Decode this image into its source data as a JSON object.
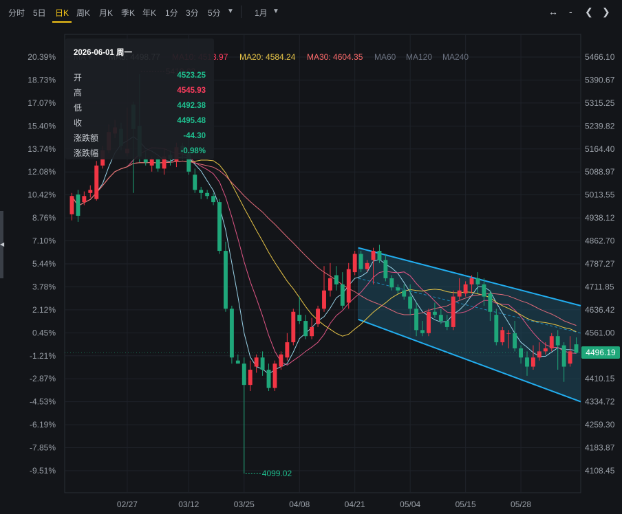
{
  "toolbar": {
    "periods": [
      {
        "label": "分时",
        "active": false
      },
      {
        "label": "5日",
        "active": false
      },
      {
        "label": "日K",
        "active": true
      },
      {
        "label": "周K",
        "active": false
      },
      {
        "label": "月K",
        "active": false
      },
      {
        "label": "季K",
        "active": false
      },
      {
        "label": "年K",
        "active": false
      },
      {
        "label": "1分",
        "active": false
      },
      {
        "label": "3分",
        "active": false
      },
      {
        "label": "5分",
        "active": false
      }
    ],
    "more_arrow": "▼",
    "range_label": "1月",
    "range_arrow": "▼",
    "right_icons": [
      "↔",
      "-",
      "❮",
      "❯"
    ]
  },
  "legend": {
    "prefix": "MA",
    "items": [
      {
        "label": "MA5: 4498.77",
        "color": "#e8e8e8"
      },
      {
        "label": "MA10: 4513.97",
        "color": "#ff3d5e"
      },
      {
        "label": "MA20: 4584.24",
        "color": "#e8c547"
      },
      {
        "label": "MA30: 4604.35",
        "color": "#ff6b6b"
      },
      {
        "label": "MA60",
        "color": "#6b7280"
      },
      {
        "label": "MA120",
        "color": "#6b7280"
      },
      {
        "label": "MA240",
        "color": "#6b7280"
      }
    ]
  },
  "tooltip": {
    "date": "2026-06-01 周一",
    "rows": [
      {
        "label": "开",
        "value": "4523.25",
        "color": "#1fbf8f"
      },
      {
        "label": "高",
        "value": "4545.93",
        "color": "#ff3d5e"
      },
      {
        "label": "低",
        "value": "4492.38",
        "color": "#1fbf8f"
      },
      {
        "label": "收",
        "value": "4495.48",
        "color": "#1fbf8f"
      },
      {
        "label": "涨跌额",
        "value": "-44.30",
        "color": "#1fbf8f"
      },
      {
        "label": "涨跌幅",
        "value": "-0.98%",
        "color": "#1fbf8f"
      }
    ]
  },
  "last_price": "4496.19",
  "colors": {
    "up": "#f23645",
    "down": "#1fa77a",
    "channel": "#22aef0",
    "channel_fill": "#1e4a5e",
    "ma5": "#9ad3e8",
    "ma10": "#e05585",
    "ma20": "#e8c547",
    "ma30": "#e36b7a"
  },
  "chart_data": {
    "type": "candlestick",
    "ylim": [
      4070,
      5505
    ],
    "y_ticks_price": [
      "5466.10",
      "5390.67",
      "5315.25",
      "5239.82",
      "5164.40",
      "5088.97",
      "5013.55",
      "4938.12",
      "4862.70",
      "4787.27",
      "4711.85",
      "4636.42",
      "4561.00",
      "4485.58",
      "4410.15",
      "4334.72",
      "4259.30",
      "4183.87",
      "4108.45"
    ],
    "y_ticks_pct": [
      "20.39%",
      "18.73%",
      "17.07%",
      "15.40%",
      "13.74%",
      "12.08%",
      "10.42%",
      "8.76%",
      "7.10%",
      "5.44%",
      "3.78%",
      "2.12%",
      "0.45%",
      "-1.21%",
      "-2.87%",
      "-4.53%",
      "-6.19%",
      "-7.85%",
      "-9.51%"
    ],
    "x_ticks": [
      {
        "i": 9,
        "label": "02/27"
      },
      {
        "i": 19,
        "label": "03/12"
      },
      {
        "i": 28,
        "label": "03/25"
      },
      {
        "i": 37,
        "label": "04/08"
      },
      {
        "i": 46,
        "label": "04/21"
      },
      {
        "i": 55,
        "label": "05/04"
      },
      {
        "i": 64,
        "label": "05/15"
      },
      {
        "i": 73,
        "label": "05/28"
      }
    ],
    "annotations": {
      "high": "5419.02",
      "low": "4099.02"
    },
    "candles": [
      [
        4950,
        5010,
        5020,
        4930
      ],
      [
        5015,
        4945,
        5030,
        4925
      ],
      [
        4990,
        5010,
        5025,
        4980
      ],
      [
        5020,
        5030,
        5045,
        5005
      ],
      [
        5000,
        5110,
        5125,
        4995
      ],
      [
        5110,
        5160,
        5175,
        5100
      ],
      [
        5160,
        5220,
        5245,
        5150
      ],
      [
        5215,
        5235,
        5260,
        5200
      ],
      [
        5230,
        5175,
        5250,
        5160
      ],
      [
        5150,
        5165,
        5300,
        5140
      ],
      [
        5310,
        5230,
        5320,
        5020
      ],
      [
        5240,
        5140,
        5410,
        5120
      ],
      [
        5130,
        5120,
        5160,
        5110
      ],
      [
        5110,
        5130,
        5140,
        5090
      ],
      [
        5130,
        5100,
        5140,
        5090
      ],
      [
        5100,
        5140,
        5165,
        5080
      ],
      [
        5145,
        5130,
        5160,
        5110
      ],
      [
        5125,
        5170,
        5185,
        5105
      ],
      [
        5175,
        5150,
        5185,
        5130
      ],
      [
        5160,
        5090,
        5200,
        5080
      ],
      [
        5080,
        5030,
        5100,
        5020
      ],
      [
        5030,
        5020,
        5040,
        5000
      ],
      [
        5020,
        5010,
        5030,
        5000
      ],
      [
        5010,
        4990,
        5020,
        4980
      ],
      [
        4990,
        4830,
        5000,
        4820
      ],
      [
        4830,
        4640,
        4860,
        4630
      ],
      [
        4640,
        4480,
        4650,
        4460
      ],
      [
        4470,
        4460,
        4490,
        4460
      ],
      [
        4460,
        4390,
        4480,
        4099
      ],
      [
        4390,
        4440,
        4470,
        4370
      ],
      [
        4450,
        4480,
        4490,
        4430
      ],
      [
        4480,
        4440,
        4500,
        4420
      ],
      [
        4440,
        4380,
        4460,
        4370
      ],
      [
        4380,
        4460,
        4470,
        4370
      ],
      [
        4450,
        4490,
        4500,
        4440
      ],
      [
        4480,
        4530,
        4560,
        4470
      ],
      [
        4530,
        4630,
        4640,
        4520
      ],
      [
        4620,
        4600,
        4680,
        4590
      ],
      [
        4600,
        4550,
        4620,
        4540
      ],
      [
        4550,
        4580,
        4610,
        4540
      ],
      [
        4590,
        4640,
        4650,
        4580
      ],
      [
        4640,
        4700,
        4780,
        4630
      ],
      [
        4700,
        4740,
        4790,
        4680
      ],
      [
        4750,
        4720,
        4780,
        4700
      ],
      [
        4720,
        4650,
        4760,
        4640
      ],
      [
        4660,
        4770,
        4790,
        4640
      ],
      [
        4760,
        4820,
        4830,
        4750
      ],
      [
        4820,
        4770,
        4830,
        4760
      ],
      [
        4770,
        4790,
        4800,
        4760
      ],
      [
        4800,
        4830,
        4840,
        4720
      ],
      [
        4830,
        4800,
        4850,
        4790
      ],
      [
        4800,
        4740,
        4820,
        4730
      ],
      [
        4740,
        4710,
        4750,
        4700
      ],
      [
        4710,
        4700,
        4720,
        4690
      ],
      [
        4700,
        4680,
        4720,
        4670
      ],
      [
        4680,
        4640,
        4720,
        4620
      ],
      [
        4640,
        4570,
        4660,
        4550
      ],
      [
        4570,
        4560,
        4600,
        4550
      ],
      [
        4560,
        4630,
        4640,
        4550
      ],
      [
        4630,
        4620,
        4660,
        4610
      ],
      [
        4620,
        4600,
        4640,
        4590
      ],
      [
        4600,
        4580,
        4620,
        4570
      ],
      [
        4580,
        4680,
        4700,
        4570
      ],
      [
        4680,
        4700,
        4740,
        4670
      ],
      [
        4690,
        4720,
        4730,
        4680
      ],
      [
        4720,
        4740,
        4750,
        4690
      ],
      [
        4740,
        4720,
        4760,
        4690
      ],
      [
        4720,
        4680,
        4740,
        4650
      ],
      [
        4690,
        4630,
        4700,
        4600
      ],
      [
        4620,
        4530,
        4640,
        4520
      ],
      [
        4530,
        4570,
        4580,
        4520
      ],
      [
        4560,
        4560,
        4570,
        4510
      ],
      [
        4560,
        4510,
        4600,
        4500
      ],
      [
        4510,
        4480,
        4520,
        4460
      ],
      [
        4480,
        4450,
        4500,
        4420
      ],
      [
        4450,
        4480,
        4520,
        4440
      ],
      [
        4480,
        4500,
        4530,
        4470
      ],
      [
        4500,
        4510,
        4530,
        4490
      ],
      [
        4510,
        4550,
        4560,
        4500
      ],
      [
        4550,
        4520,
        4570,
        4440
      ],
      [
        4520,
        4450,
        4530,
        4400
      ],
      [
        4460,
        4500,
        4550,
        4450
      ],
      [
        4523.25,
        4495.48,
        4545.93,
        4492.38
      ]
    ],
    "ma_series": [
      {
        "name": "MA5",
        "color_key": "ma5"
      },
      {
        "name": "MA10",
        "color_key": "ma10"
      },
      {
        "name": "MA20",
        "color_key": "ma20"
      },
      {
        "name": "MA30",
        "color_key": "ma30"
      }
    ],
    "channel": {
      "start_index": 47,
      "upper": [
        4840,
        4650
      ],
      "lower": [
        4605,
        4335
      ],
      "mid_dash": [
        4740,
        4560
      ]
    }
  }
}
